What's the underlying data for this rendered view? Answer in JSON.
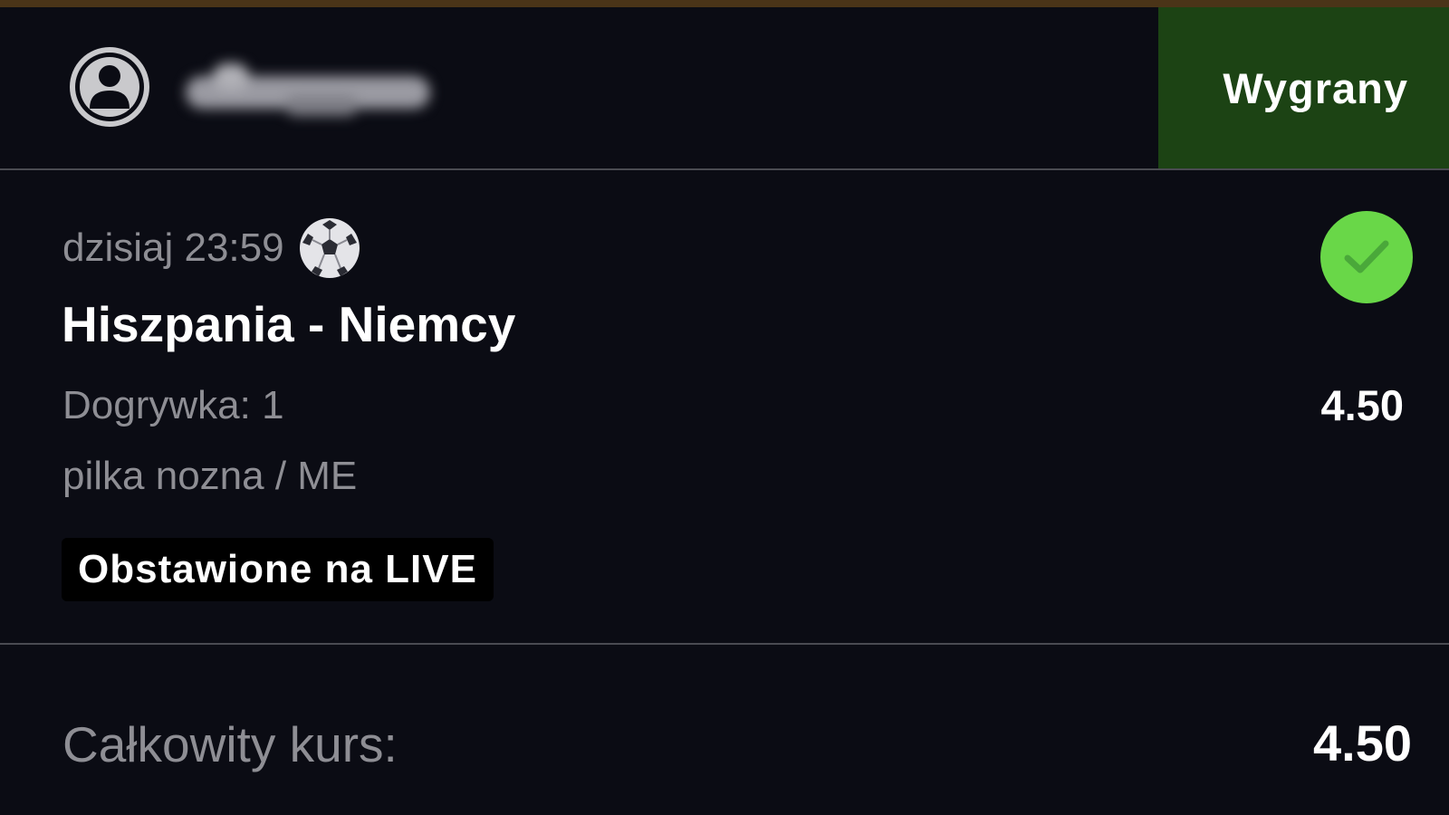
{
  "header": {
    "status_label": "Wygrany"
  },
  "bet": {
    "datetime": "dzisiaj 23:59",
    "sport_icon": "soccer-ball-icon",
    "match": "Hiszpania - Niemcy",
    "market": "Dogrywka: 1",
    "odd": "4.50",
    "sport": "pilka nozna / ME",
    "live_badge": "Obstawione na LIVE",
    "result_icon": "checkmark-icon"
  },
  "summary": {
    "total_label": "Całkowity kurs:",
    "total_value": "4.50"
  },
  "colors": {
    "background": "#0b0c14",
    "won_block": "#1c4314",
    "check_green": "#69d748",
    "muted_text": "#8e8e94",
    "top_strip": "#4a3418"
  }
}
